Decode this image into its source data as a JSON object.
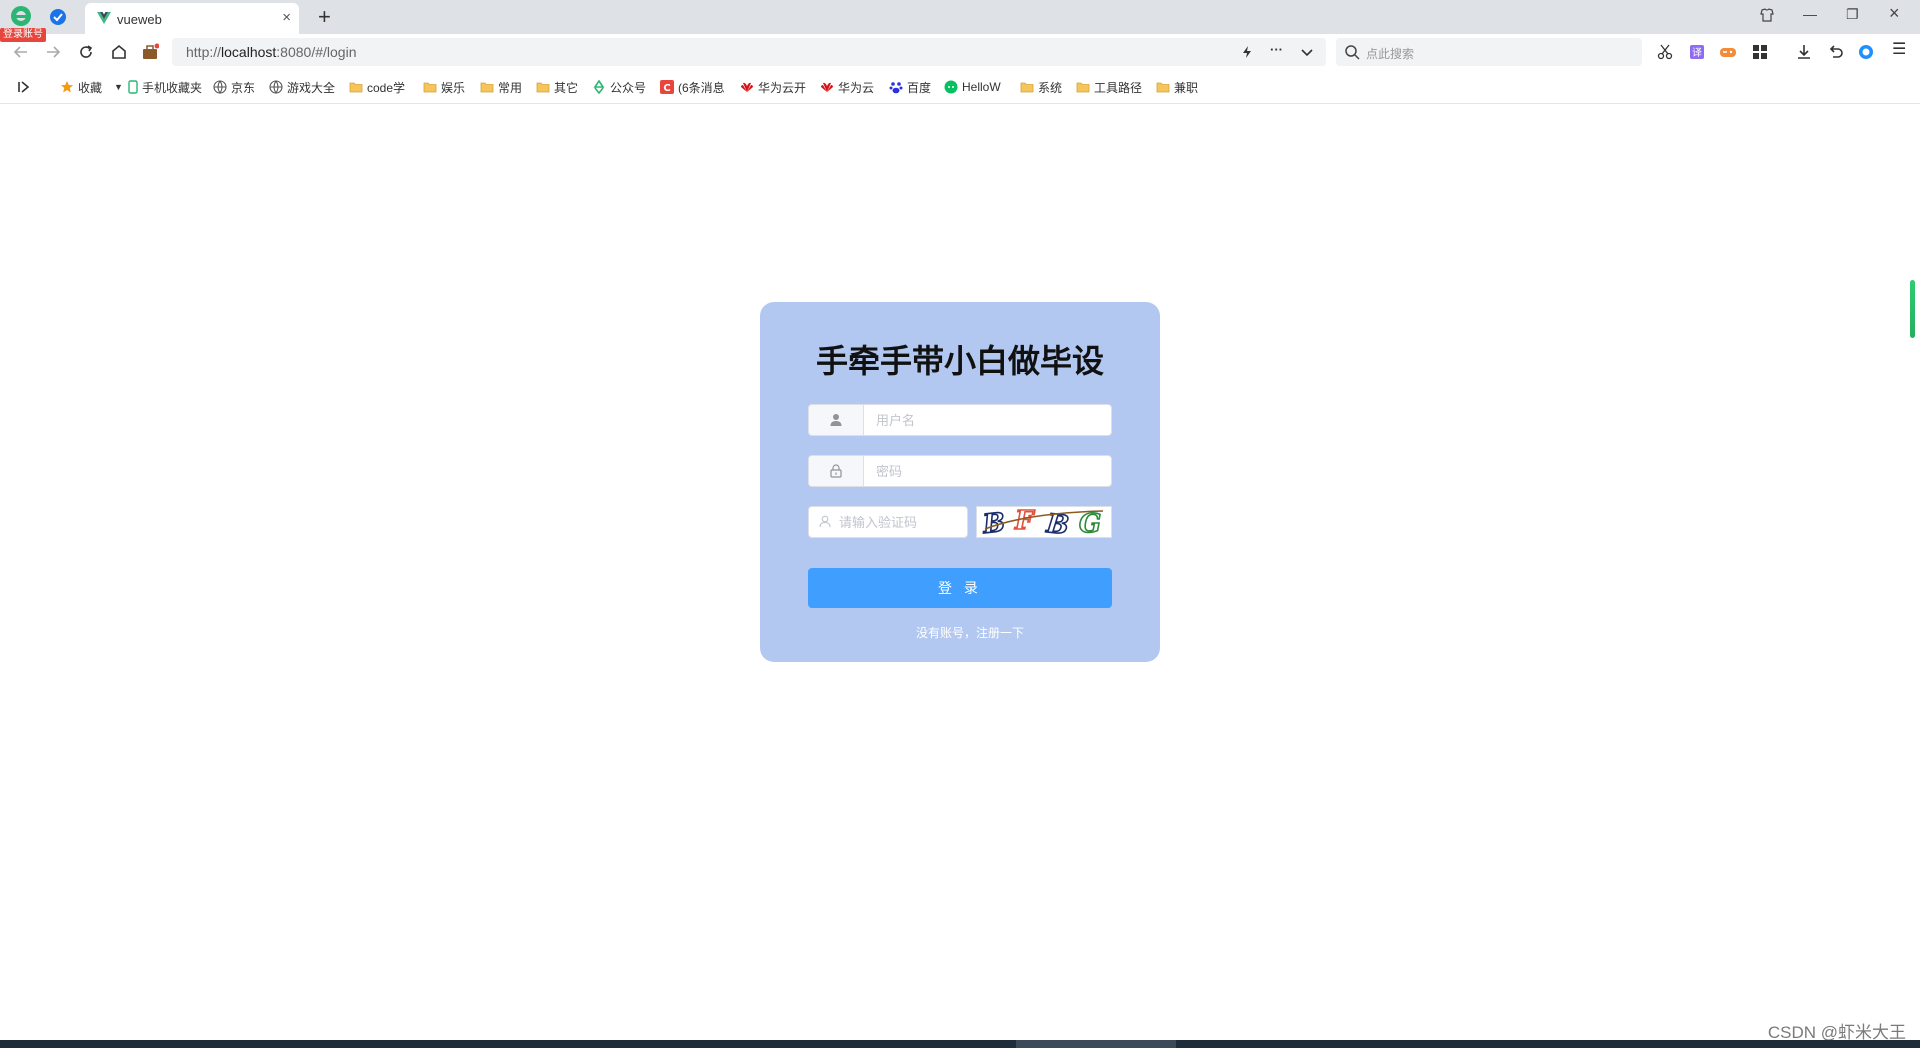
{
  "browser": {
    "badge": "登录账号",
    "tab_title": "vueweb",
    "tab_close": "×",
    "new_tab": "+",
    "url_prefix": "http://",
    "url_host": "localhost",
    "url_rest": ":8080/#/login",
    "address_more": "···",
    "search_placeholder": "点此搜索",
    "window_restore": "❐",
    "window_min": "—",
    "window_close": "×",
    "window_menu": "☰"
  },
  "bookmarks": [
    {
      "label": "收藏",
      "icon": "star-icon"
    },
    {
      "label": "手机收藏夹",
      "icon": "phone-icon"
    },
    {
      "label": "京东",
      "icon": "globe-icon"
    },
    {
      "label": "游戏大全",
      "icon": "globe-icon"
    },
    {
      "label": "code学",
      "icon": "folder-icon"
    },
    {
      "label": "娱乐",
      "icon": "folder-icon"
    },
    {
      "label": "常用",
      "icon": "folder-icon"
    },
    {
      "label": "其它",
      "icon": "folder-icon"
    },
    {
      "label": "公众号",
      "icon": "recycle-icon"
    },
    {
      "label": "(6条消息",
      "icon": "csdn-icon"
    },
    {
      "label": "华为云开",
      "icon": "huawei-icon"
    },
    {
      "label": "华为云",
      "icon": "huawei-icon"
    },
    {
      "label": "百度",
      "icon": "baidu-icon"
    },
    {
      "label": "HelloW",
      "icon": "wechat-icon"
    },
    {
      "label": "系统",
      "icon": "folder-icon"
    },
    {
      "label": "工具路径",
      "icon": "folder-icon"
    },
    {
      "label": "兼职",
      "icon": "folder-icon"
    }
  ],
  "login": {
    "title": "手牵手带小白做毕设",
    "username_placeholder": "用户名",
    "password_placeholder": "密码",
    "captcha_placeholder": "请输入验证码",
    "captcha_text": "BFBG",
    "login_label": "登 录",
    "register_label": "没有账号，注册一下"
  },
  "watermark": "CSDN @虾米大王",
  "colors": {
    "card_bg": "#b3c8f0",
    "button_bg": "#409eff"
  }
}
